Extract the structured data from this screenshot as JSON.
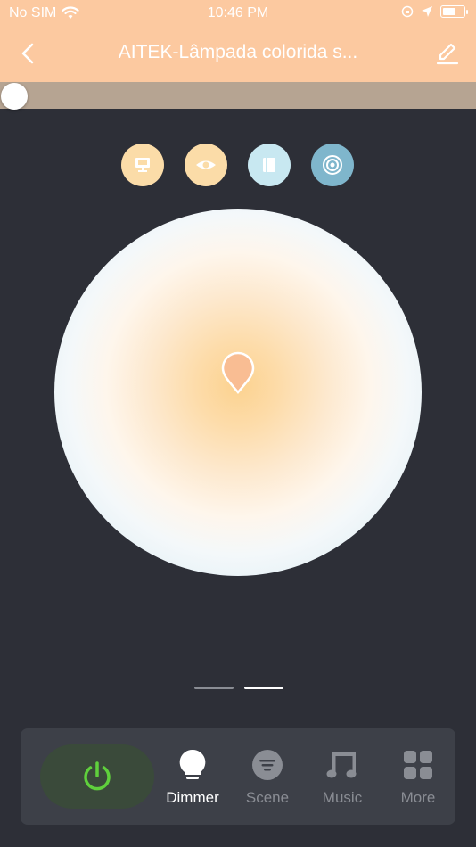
{
  "status_bar": {
    "carrier": "No SIM",
    "time": "10:46 PM"
  },
  "header": {
    "title": "AITEK-Lâmpada colorida s..."
  },
  "brightness": {
    "level": 0
  },
  "modes": [
    {
      "name": "monitor-mode",
      "color": "#fbdca8"
    },
    {
      "name": "eye-mode",
      "color": "#fbdca8"
    },
    {
      "name": "book-mode",
      "color": "#c8e8f1"
    },
    {
      "name": "target-mode",
      "color": "#7fb6cc"
    }
  ],
  "pager": {
    "pages": 2,
    "active_page": 2
  },
  "tabs": {
    "dimmer": "Dimmer",
    "scene": "Scene",
    "music": "Music",
    "more": "More"
  },
  "colors": {
    "header_bg": "#fcc9a0",
    "slider_bg": "#b6a492",
    "page_bg": "#2d2f37",
    "power_green": "#5fd03c",
    "pin": "#f9bd93",
    "tab_active": "#ffffff",
    "tab_inactive": "#8a8d94"
  }
}
